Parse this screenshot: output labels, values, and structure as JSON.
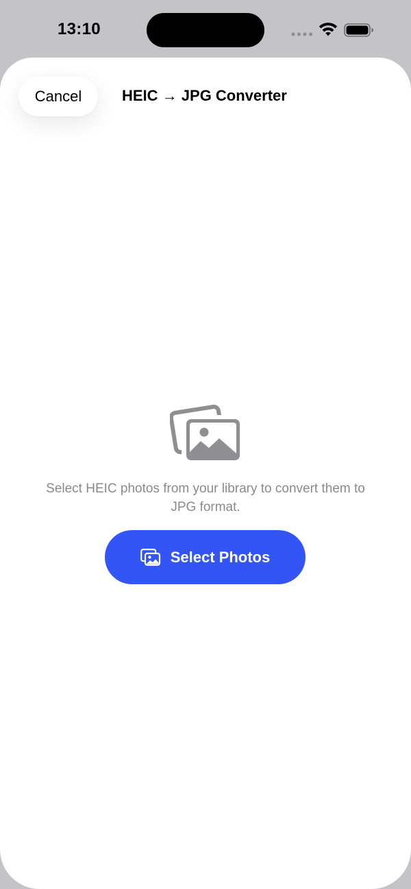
{
  "status_bar": {
    "time": "13:10"
  },
  "nav": {
    "cancel_label": "Cancel",
    "title": "HEIC → JPG Converter"
  },
  "empty_state": {
    "icon": "photos-stack-icon",
    "description": "Select HEIC photos from your library to convert them to JPG format."
  },
  "select_button": {
    "icon": "photos-icon",
    "label": "Select Photos"
  },
  "colors": {
    "accent": "#3355f6",
    "background": "#ffffff",
    "secondary_text": "#8a8a8e",
    "icon_gray": "#8e8e93",
    "outer_background": "#c4c3c8"
  }
}
